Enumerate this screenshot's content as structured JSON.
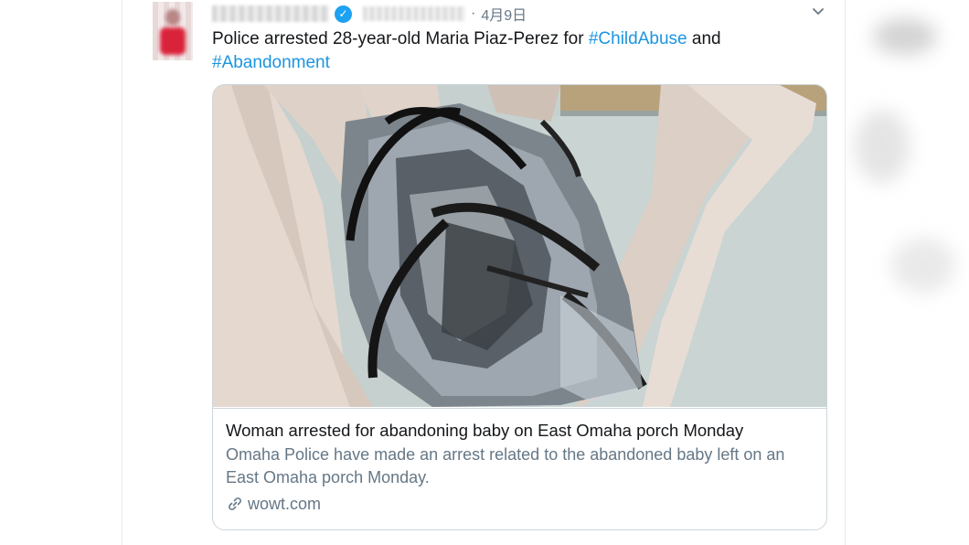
{
  "tweet": {
    "date": "4月9日",
    "separator": "·",
    "text_prefix": "Police arrested 28-year-old Maria Piaz-Perez for ",
    "hashtag_1": "#ChildAbuse",
    "text_middle": " and",
    "hashtag_2": "#Abandonment"
  },
  "card": {
    "title": "Woman arrested for abandoning baby on East Omaha porch Monday",
    "description": "Omaha Police have made an arrest related to the abandoned baby left on an East Omaha porch Monday.",
    "domain": "wowt.com"
  },
  "icons": {
    "verified": "verified-badge-icon",
    "menu": "chevron-down-icon",
    "link": "link-icon"
  },
  "colors": {
    "accent": "#1b95e0",
    "verified": "#1da1f2",
    "muted": "#657786",
    "border": "#ccd6dd"
  }
}
